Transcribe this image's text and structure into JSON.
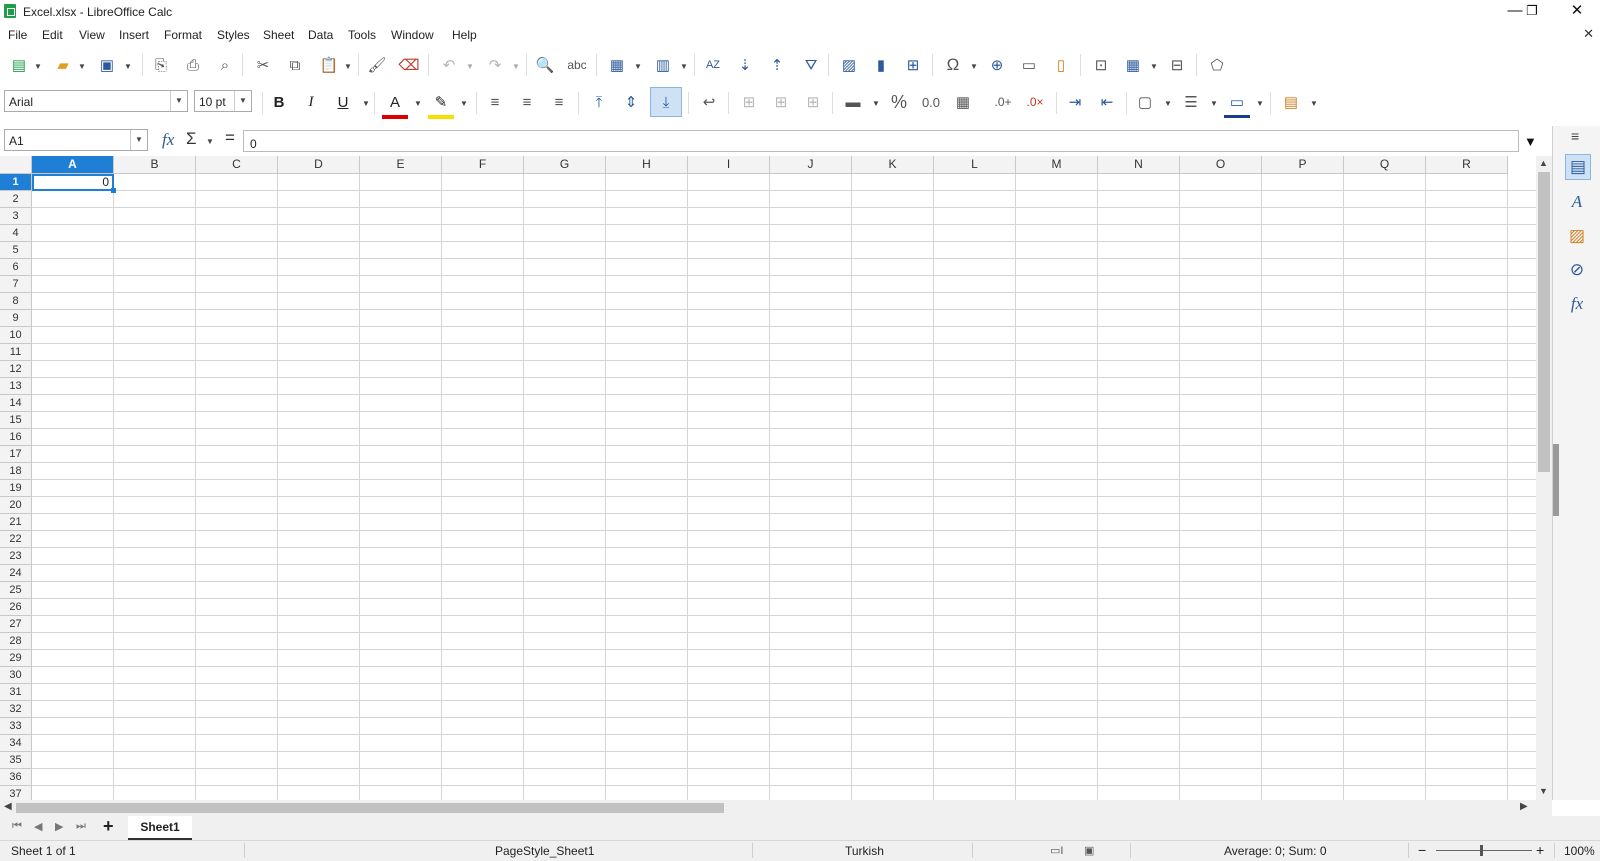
{
  "window": {
    "title": "Excel.xlsx - LibreOffice Calc",
    "minimize": "—",
    "restore": "❐",
    "close": "✕",
    "close_doc": "✕"
  },
  "menu": [
    "File",
    "Edit",
    "View",
    "Insert",
    "Format",
    "Styles",
    "Sheet",
    "Data",
    "Tools",
    "Window",
    "Help"
  ],
  "format_bar": {
    "font_name": "Arial",
    "font_size": "10 pt",
    "bold": "B",
    "italic": "I",
    "underline": "U",
    "percent": "%",
    "number": "0.0"
  },
  "formula_bar": {
    "cell_ref": "A1",
    "fx": "fx",
    "sum": "Σ",
    "equals": "=",
    "content": "0"
  },
  "columns": [
    "A",
    "B",
    "C",
    "D",
    "E",
    "F",
    "G",
    "H",
    "I",
    "J",
    "K",
    "L",
    "M",
    "N",
    "O",
    "P",
    "Q",
    "R"
  ],
  "rows": [
    "1",
    "2",
    "3",
    "4",
    "5",
    "6",
    "7",
    "8",
    "9",
    "10",
    "11",
    "12",
    "13",
    "14",
    "15",
    "16",
    "17",
    "18",
    "19",
    "20",
    "21",
    "22",
    "23",
    "24",
    "25",
    "26",
    "27",
    "28",
    "29",
    "30",
    "31",
    "32",
    "33",
    "34",
    "35",
    "36",
    "37"
  ],
  "active_cell": {
    "ref": "A1",
    "value": "0"
  },
  "sheets": {
    "add": "+",
    "tabs": [
      "Sheet1"
    ]
  },
  "status": {
    "sheet_info": "Sheet 1 of 1",
    "page_style": "PageStyle_Sheet1",
    "language": "Turkish",
    "summary": "Average: 0; Sum: 0",
    "zoom_minus": "−",
    "zoom_plus": "+",
    "zoom": "100%"
  },
  "colors": {
    "accent": "#1f7fd6",
    "icon_blue": "#2c5a9c",
    "calc_green": "#1e9e48"
  }
}
